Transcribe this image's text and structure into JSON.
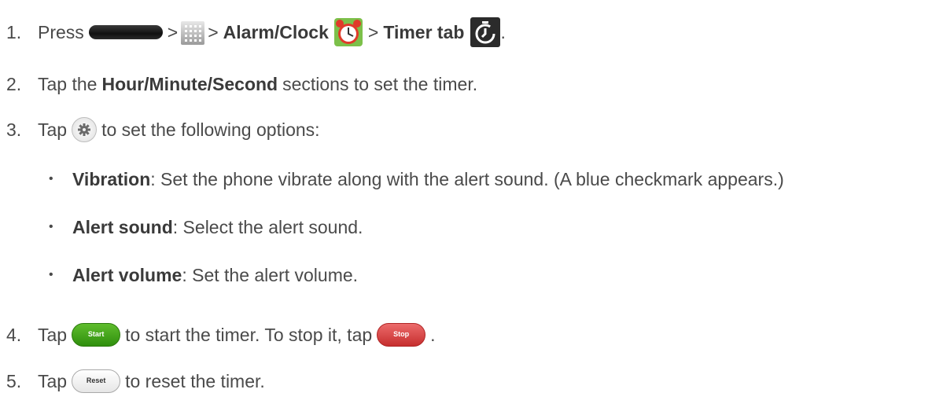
{
  "steps": [
    {
      "num": "1.",
      "press": "Press",
      "sep": ">",
      "app_name": "Alarm/Clock",
      "tab_name": "Timer tab",
      "end": ".",
      "icons": [
        "home-key",
        "apps-icon",
        "alarm-clock-icon",
        "timer-tab-icon"
      ]
    },
    {
      "num": "2.",
      "tap": "Tap the",
      "hour": "Hour",
      "slash": "/",
      "minute": "Minute",
      "second": "Second",
      "rest": "sections to set the timer."
    },
    {
      "num": "3.",
      "tap": "Tap",
      "rest": "to set the following options:",
      "icon": "gear-icon"
    },
    {
      "num": "4.",
      "tap": "Tap",
      "start_label": "Start",
      "middle": "to start the timer. To stop it, tap",
      "stop_label": "Stop",
      "end": "."
    },
    {
      "num": "5.",
      "tap": "Tap",
      "reset_label": "Reset",
      "rest": "to reset the timer."
    }
  ],
  "options": [
    {
      "term": "Vibration",
      "desc": ": Set the phone vibrate along with the alert sound. (A blue checkmark appears.)"
    },
    {
      "term": "Alert sound",
      "desc": ": Select the alert sound."
    },
    {
      "term": "Alert volume",
      "desc": ": Set the alert volume."
    }
  ],
  "bullet": "•",
  "colors": {
    "text": "#4a4a4a",
    "start": "#3a9d17",
    "stop": "#d43b3b"
  }
}
